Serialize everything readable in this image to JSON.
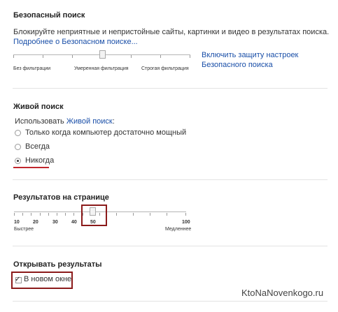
{
  "safe_search": {
    "title": "Безопасный поиск",
    "description": "Блокируйте неприятные и непристойные сайты, картинки и видео в результатах поиска.",
    "more_link": "Подробнее о Безопасном поиске...",
    "levels": [
      "Без фильтрации",
      "Умеренная фильтрация",
      "Строгая фильтрация"
    ],
    "selected_level": "Умеренная фильтрация",
    "lock_link_line1": "Включить защиту настроек",
    "lock_link_line2": "Безопасного поиска"
  },
  "instant": {
    "title": "Живой поиск",
    "use_prefix": "Использовать",
    "use_link": "Живой поиск",
    "use_suffix": ":",
    "options": [
      {
        "label": "Только когда компьютер достаточно мощный",
        "checked": false
      },
      {
        "label": "Всегда",
        "checked": false
      },
      {
        "label": "Никогда",
        "checked": true
      }
    ]
  },
  "results_per_page": {
    "title": "Результатов на странице",
    "values": [
      "10",
      "20",
      "30",
      "40",
      "50",
      "100"
    ],
    "selected": "50",
    "fast_label": "Быстрее",
    "slow_label": "Медленнее"
  },
  "open_results": {
    "title": "Открывать результаты",
    "checkbox_label": "В новом окне",
    "checked": true
  },
  "watermark": "KtoNaNovenkogo.ru",
  "colors": {
    "link": "#1a4fa8",
    "highlight": "#8b1a1a",
    "underline": "#c0272d",
    "divider": "#e3e3e3"
  }
}
